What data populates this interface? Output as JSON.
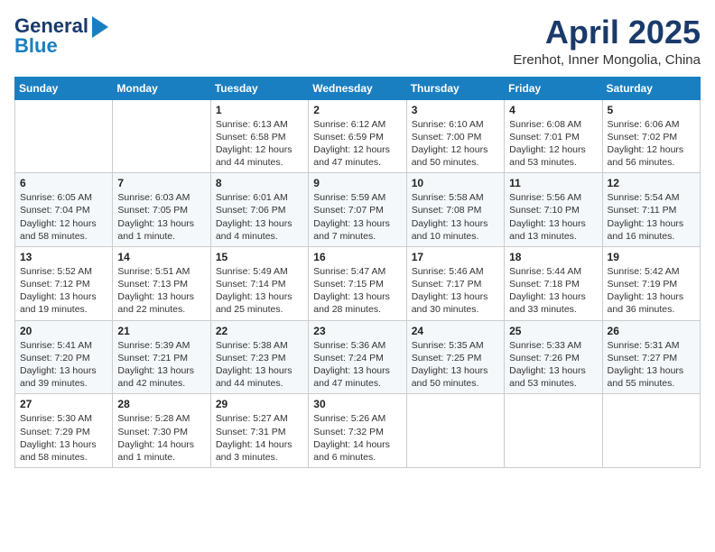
{
  "header": {
    "logo_line1": "General",
    "logo_line2": "Blue",
    "month": "April 2025",
    "location": "Erenhot, Inner Mongolia, China"
  },
  "weekdays": [
    "Sunday",
    "Monday",
    "Tuesday",
    "Wednesday",
    "Thursday",
    "Friday",
    "Saturday"
  ],
  "weeks": [
    [
      {
        "day": "",
        "info": ""
      },
      {
        "day": "",
        "info": ""
      },
      {
        "day": "1",
        "info": "Sunrise: 6:13 AM\nSunset: 6:58 PM\nDaylight: 12 hours\nand 44 minutes."
      },
      {
        "day": "2",
        "info": "Sunrise: 6:12 AM\nSunset: 6:59 PM\nDaylight: 12 hours\nand 47 minutes."
      },
      {
        "day": "3",
        "info": "Sunrise: 6:10 AM\nSunset: 7:00 PM\nDaylight: 12 hours\nand 50 minutes."
      },
      {
        "day": "4",
        "info": "Sunrise: 6:08 AM\nSunset: 7:01 PM\nDaylight: 12 hours\nand 53 minutes."
      },
      {
        "day": "5",
        "info": "Sunrise: 6:06 AM\nSunset: 7:02 PM\nDaylight: 12 hours\nand 56 minutes."
      }
    ],
    [
      {
        "day": "6",
        "info": "Sunrise: 6:05 AM\nSunset: 7:04 PM\nDaylight: 12 hours\nand 58 minutes."
      },
      {
        "day": "7",
        "info": "Sunrise: 6:03 AM\nSunset: 7:05 PM\nDaylight: 13 hours\nand 1 minute."
      },
      {
        "day": "8",
        "info": "Sunrise: 6:01 AM\nSunset: 7:06 PM\nDaylight: 13 hours\nand 4 minutes."
      },
      {
        "day": "9",
        "info": "Sunrise: 5:59 AM\nSunset: 7:07 PM\nDaylight: 13 hours\nand 7 minutes."
      },
      {
        "day": "10",
        "info": "Sunrise: 5:58 AM\nSunset: 7:08 PM\nDaylight: 13 hours\nand 10 minutes."
      },
      {
        "day": "11",
        "info": "Sunrise: 5:56 AM\nSunset: 7:10 PM\nDaylight: 13 hours\nand 13 minutes."
      },
      {
        "day": "12",
        "info": "Sunrise: 5:54 AM\nSunset: 7:11 PM\nDaylight: 13 hours\nand 16 minutes."
      }
    ],
    [
      {
        "day": "13",
        "info": "Sunrise: 5:52 AM\nSunset: 7:12 PM\nDaylight: 13 hours\nand 19 minutes."
      },
      {
        "day": "14",
        "info": "Sunrise: 5:51 AM\nSunset: 7:13 PM\nDaylight: 13 hours\nand 22 minutes."
      },
      {
        "day": "15",
        "info": "Sunrise: 5:49 AM\nSunset: 7:14 PM\nDaylight: 13 hours\nand 25 minutes."
      },
      {
        "day": "16",
        "info": "Sunrise: 5:47 AM\nSunset: 7:15 PM\nDaylight: 13 hours\nand 28 minutes."
      },
      {
        "day": "17",
        "info": "Sunrise: 5:46 AM\nSunset: 7:17 PM\nDaylight: 13 hours\nand 30 minutes."
      },
      {
        "day": "18",
        "info": "Sunrise: 5:44 AM\nSunset: 7:18 PM\nDaylight: 13 hours\nand 33 minutes."
      },
      {
        "day": "19",
        "info": "Sunrise: 5:42 AM\nSunset: 7:19 PM\nDaylight: 13 hours\nand 36 minutes."
      }
    ],
    [
      {
        "day": "20",
        "info": "Sunrise: 5:41 AM\nSunset: 7:20 PM\nDaylight: 13 hours\nand 39 minutes."
      },
      {
        "day": "21",
        "info": "Sunrise: 5:39 AM\nSunset: 7:21 PM\nDaylight: 13 hours\nand 42 minutes."
      },
      {
        "day": "22",
        "info": "Sunrise: 5:38 AM\nSunset: 7:23 PM\nDaylight: 13 hours\nand 44 minutes."
      },
      {
        "day": "23",
        "info": "Sunrise: 5:36 AM\nSunset: 7:24 PM\nDaylight: 13 hours\nand 47 minutes."
      },
      {
        "day": "24",
        "info": "Sunrise: 5:35 AM\nSunset: 7:25 PM\nDaylight: 13 hours\nand 50 minutes."
      },
      {
        "day": "25",
        "info": "Sunrise: 5:33 AM\nSunset: 7:26 PM\nDaylight: 13 hours\nand 53 minutes."
      },
      {
        "day": "26",
        "info": "Sunrise: 5:31 AM\nSunset: 7:27 PM\nDaylight: 13 hours\nand 55 minutes."
      }
    ],
    [
      {
        "day": "27",
        "info": "Sunrise: 5:30 AM\nSunset: 7:29 PM\nDaylight: 13 hours\nand 58 minutes."
      },
      {
        "day": "28",
        "info": "Sunrise: 5:28 AM\nSunset: 7:30 PM\nDaylight: 14 hours\nand 1 minute."
      },
      {
        "day": "29",
        "info": "Sunrise: 5:27 AM\nSunset: 7:31 PM\nDaylight: 14 hours\nand 3 minutes."
      },
      {
        "day": "30",
        "info": "Sunrise: 5:26 AM\nSunset: 7:32 PM\nDaylight: 14 hours\nand 6 minutes."
      },
      {
        "day": "",
        "info": ""
      },
      {
        "day": "",
        "info": ""
      },
      {
        "day": "",
        "info": ""
      }
    ]
  ]
}
